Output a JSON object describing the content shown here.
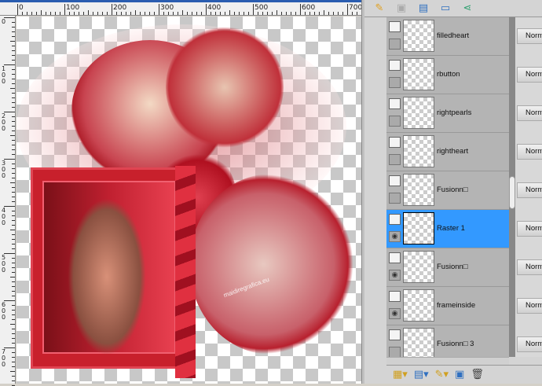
{
  "ruler": {
    "h_labels": [
      "0",
      "100",
      "200",
      "300",
      "400",
      "500",
      "600",
      "700"
    ],
    "v_labels": [
      "0",
      "100",
      "200",
      "300",
      "400",
      "500",
      "600",
      "700"
    ]
  },
  "canvas": {
    "watermark": "maidiregrafica.eu"
  },
  "layers_toolbar": {
    "icons": [
      "paint-brush-icon",
      "mask-icon",
      "layer-properties-icon",
      "edit-selection-icon",
      "share-icon"
    ]
  },
  "layers": [
    {
      "name": "filledheart",
      "visible": false,
      "selected": false,
      "blend": "Norm"
    },
    {
      "name": "rbutton",
      "visible": false,
      "selected": false,
      "blend": "Norm"
    },
    {
      "name": "rightpearls",
      "visible": false,
      "selected": false,
      "blend": "Norm"
    },
    {
      "name": "rightheart",
      "visible": false,
      "selected": false,
      "blend": "Norm"
    },
    {
      "name": "Fusionn□",
      "visible": false,
      "selected": false,
      "blend": "Norm"
    },
    {
      "name": "Raster 1",
      "visible": true,
      "selected": true,
      "blend": "Norm"
    },
    {
      "name": "Fusionn□",
      "visible": true,
      "selected": false,
      "blend": "Norm"
    },
    {
      "name": "frameinside",
      "visible": true,
      "selected": false,
      "blend": "Norm"
    },
    {
      "name": "Fusionn□ 3",
      "visible": false,
      "selected": false,
      "blend": "Norm"
    }
  ],
  "bottom_toolbar": {
    "icons": [
      "new-layer-icon",
      "new-mask-icon",
      "paint-brush-icon",
      "merge-icon",
      "trash-icon"
    ]
  },
  "colors": {
    "selection": "#3399ff",
    "accent_red": "#c8182a"
  }
}
